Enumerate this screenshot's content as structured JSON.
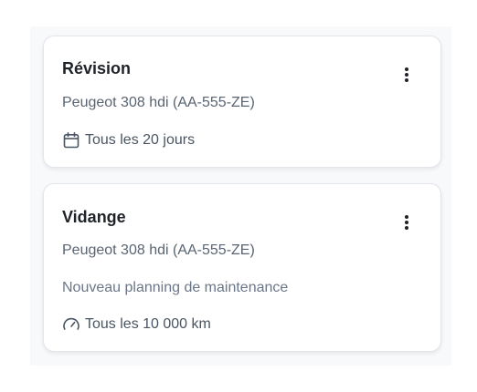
{
  "cards": [
    {
      "title": "Révision",
      "vehicle": "Peugeot 308 hdi (AA-555-ZE)",
      "frequency_icon": "calendar-icon",
      "frequency": "Tous les 20 jours",
      "menu_icon": "more-vertical-icon"
    },
    {
      "title": "Vidange",
      "vehicle": "Peugeot 308 hdi (AA-555-ZE)",
      "subtitle": "Nouveau planning de maintenance",
      "frequency_icon": "gauge-icon",
      "frequency": "Tous les 10 000 km",
      "menu_icon": "more-vertical-icon"
    }
  ],
  "colors": {
    "background": "#f8f9fb",
    "card": "#ffffff",
    "title": "#1f2328",
    "text": "#5a6472",
    "icon": "#4a5563"
  }
}
